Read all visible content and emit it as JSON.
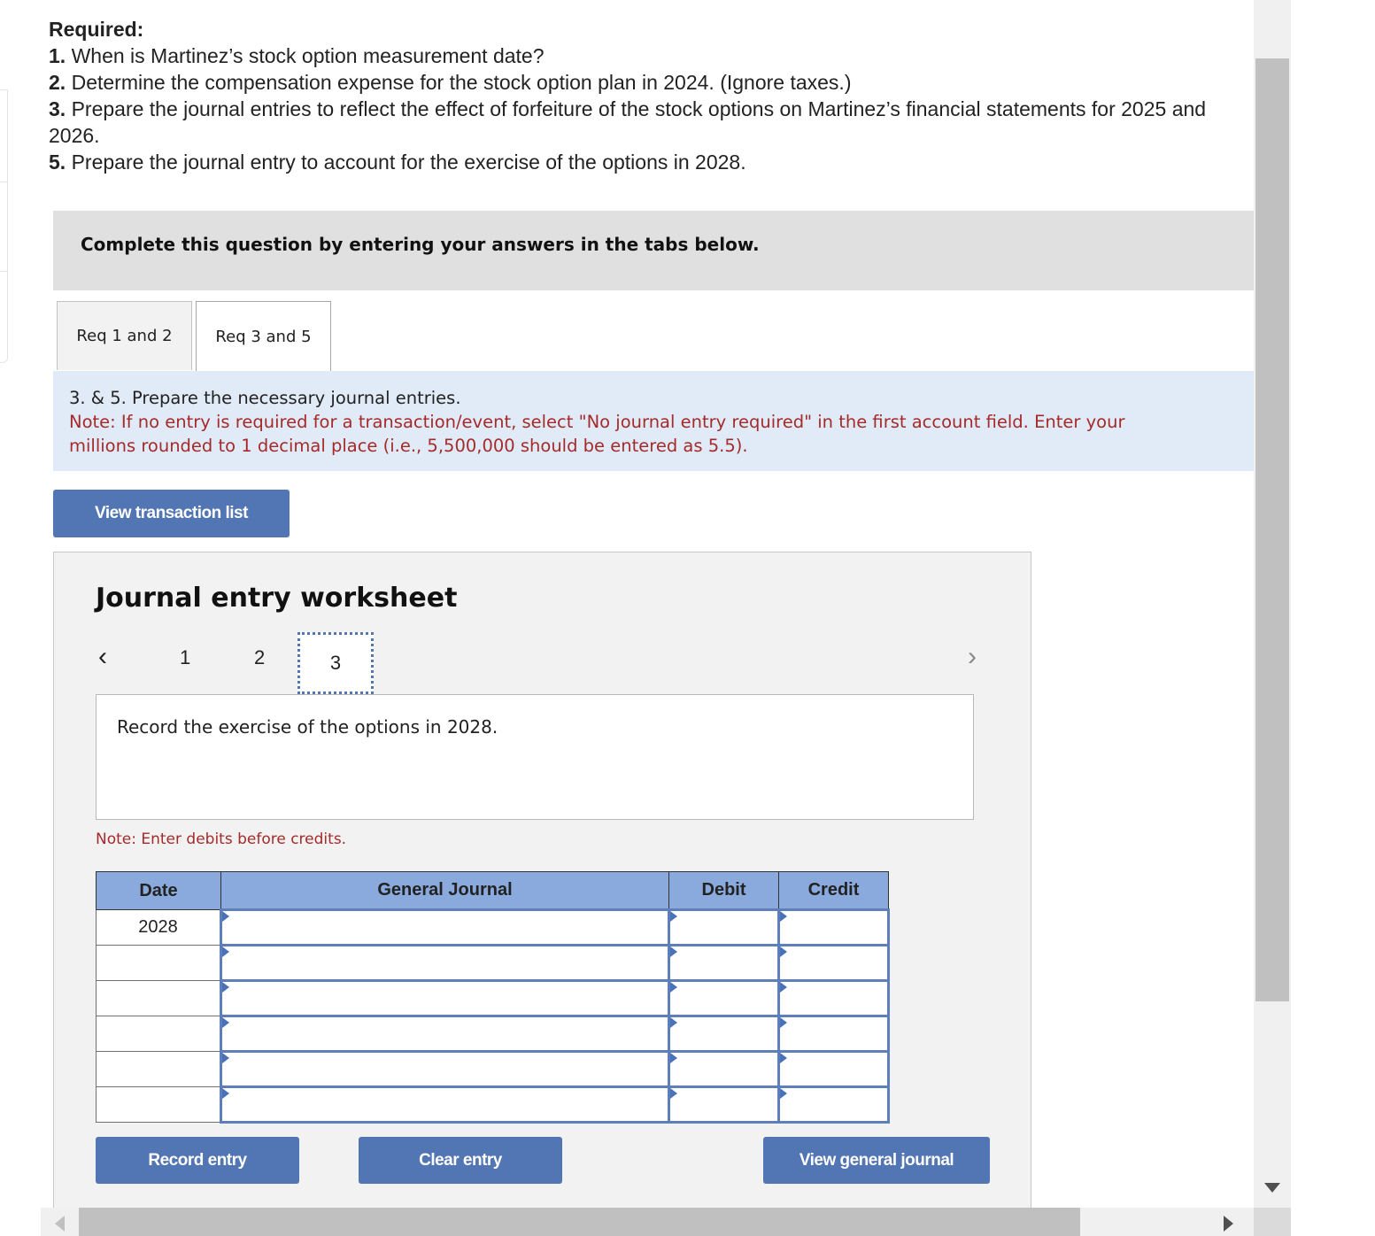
{
  "required": {
    "title": "Required:",
    "items": [
      {
        "num": "1.",
        "text": " When is Martinez’s stock option measurement date?"
      },
      {
        "num": "2.",
        "text": " Determine the compensation expense for the stock option plan in 2024. (Ignore taxes.)"
      },
      {
        "num": "3.",
        "text": " Prepare the journal entries to reflect the effect of forfeiture of the stock options on Martinez’s financial statements for 2025 and 2026."
      },
      {
        "num": "5.",
        "text": " Prepare the journal entry to account for the exercise of the options in 2028."
      }
    ]
  },
  "instruction": "Complete this question by entering your answers in the tabs below.",
  "tabs": [
    {
      "label": "Req 1 and 2",
      "active": false
    },
    {
      "label": "Req 3 and 5",
      "active": true
    }
  ],
  "prompt": {
    "heading": "3. & 5. Prepare the necessary journal entries.",
    "note_line1": "Note: If no entry is required for a transaction/event, select \"No journal entry required\" in the first account field. Enter your",
    "note_line2": "millions rounded to 1 decimal place (i.e., 5,500,000 should be entered as 5.5)."
  },
  "buttons": {
    "view_transactions": "View transaction list",
    "record_entry": "Record entry",
    "clear_entry": "Clear entry",
    "view_general_journal": "View general journal"
  },
  "worksheet": {
    "title": "Journal entry worksheet",
    "pages": [
      "1",
      "2",
      "3"
    ],
    "current_page": "3",
    "prev_icon": "‹",
    "next_icon": "›",
    "description": "Record the exercise of the options in 2028.",
    "note": "Note: Enter debits before credits."
  },
  "journal": {
    "headers": {
      "date": "Date",
      "account": "General Journal",
      "debit": "Debit",
      "credit": "Credit"
    },
    "rows": [
      {
        "date": "2028",
        "account": "",
        "debit": "",
        "credit": ""
      },
      {
        "date": "",
        "account": "",
        "debit": "",
        "credit": ""
      },
      {
        "date": "",
        "account": "",
        "debit": "",
        "credit": ""
      },
      {
        "date": "",
        "account": "",
        "debit": "",
        "credit": ""
      },
      {
        "date": "",
        "account": "",
        "debit": "",
        "credit": ""
      },
      {
        "date": "",
        "account": "",
        "debit": "",
        "credit": ""
      }
    ]
  },
  "colors": {
    "button": "#5275b3",
    "header": "#8aaadd",
    "note": "#a52a2a",
    "prompt_bg": "#e0ebf7"
  }
}
